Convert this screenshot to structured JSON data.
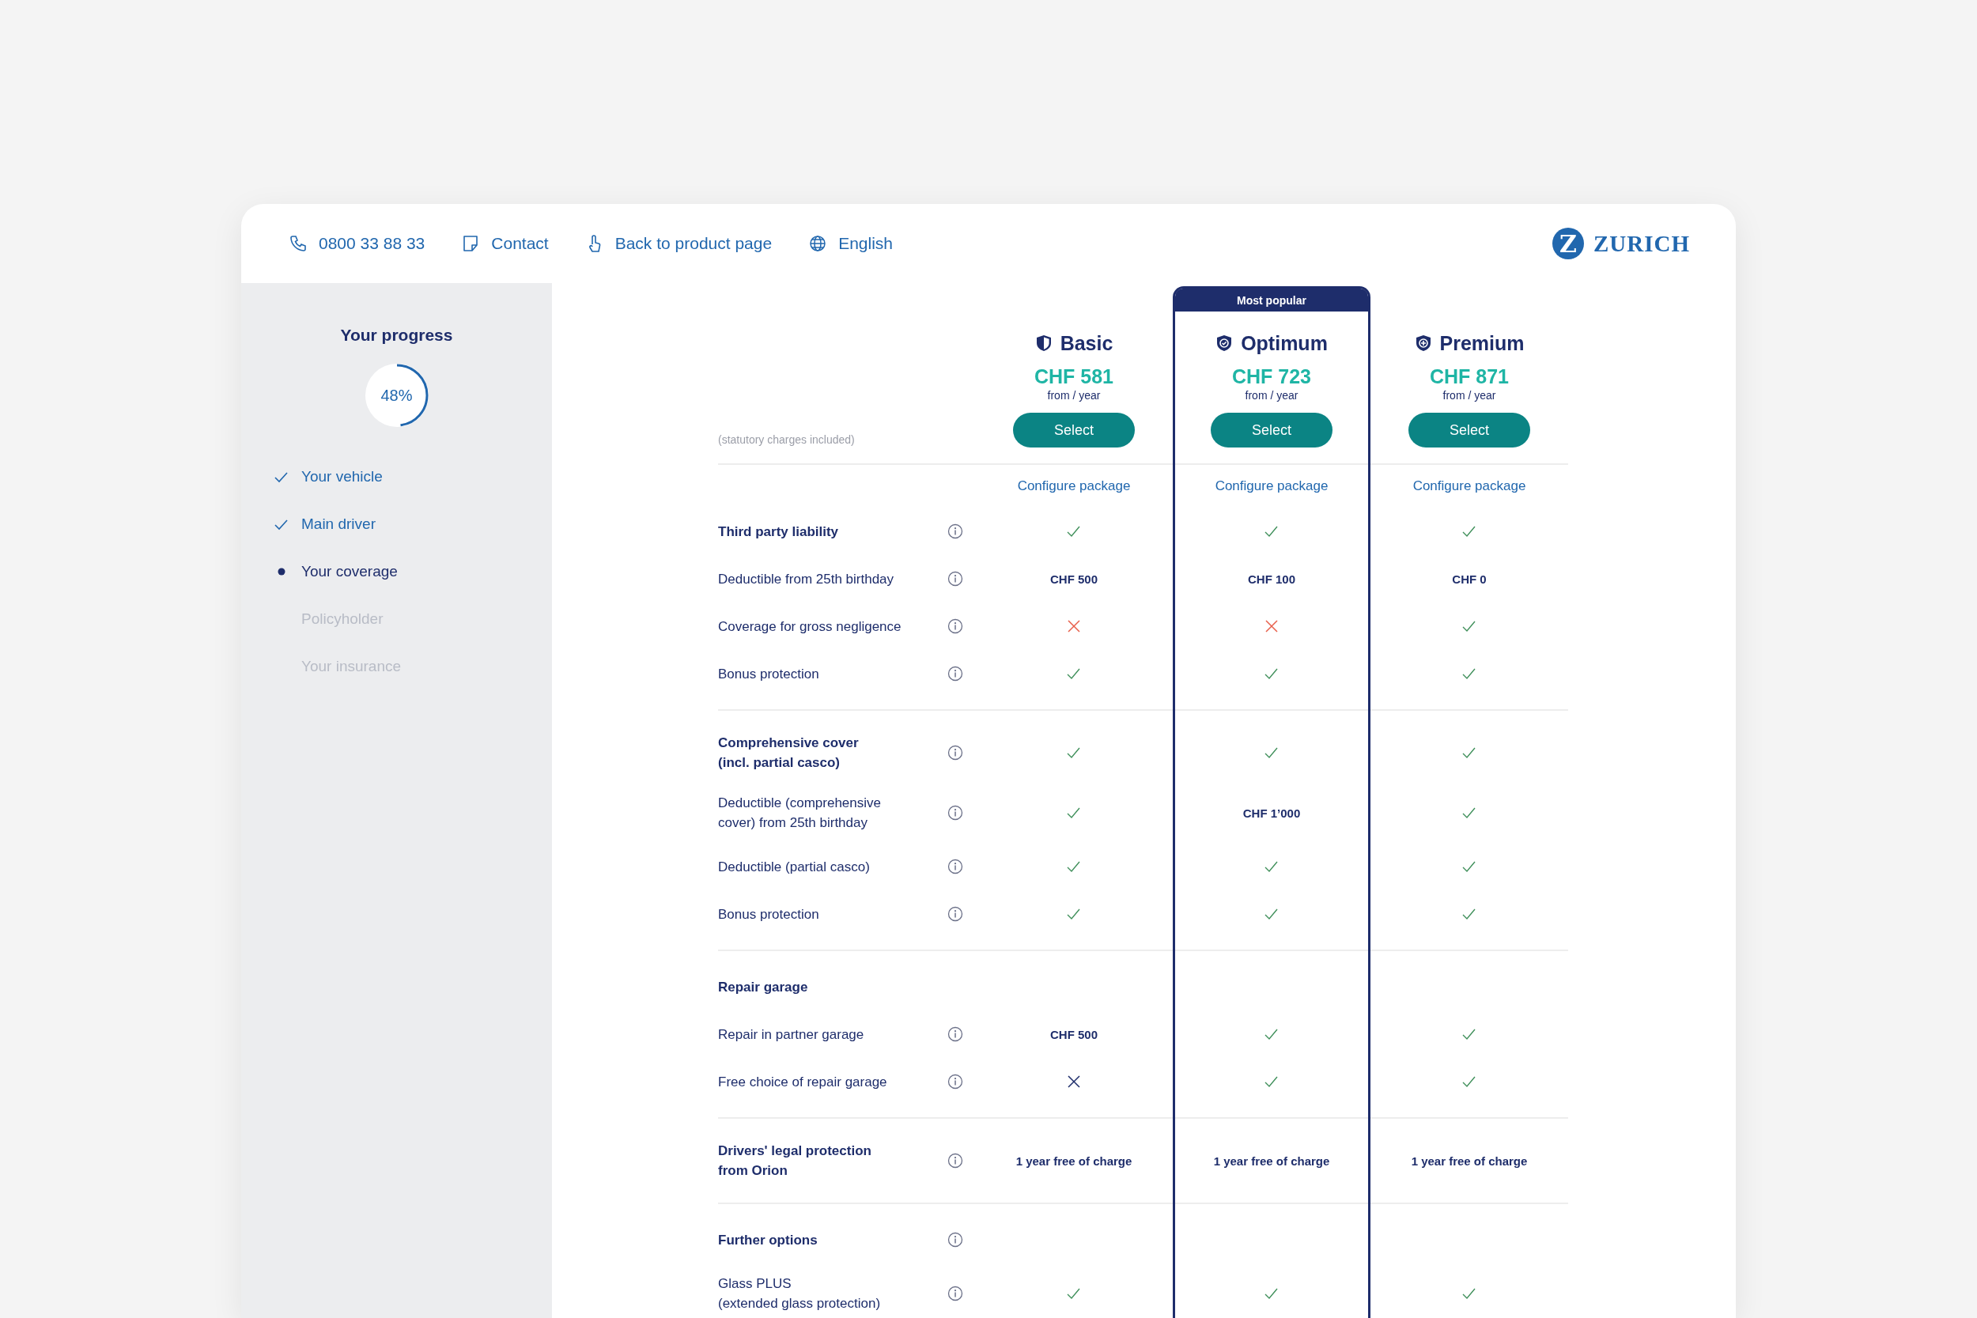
{
  "header": {
    "links": [
      {
        "text": "0800 33 88 33"
      },
      {
        "text": "Contact"
      },
      {
        "text": "Back to product page"
      },
      {
        "text": "English"
      }
    ],
    "logo": {
      "mark": "Z",
      "wordmark": "ZURICH"
    }
  },
  "sidebar": {
    "title": "Your progress",
    "progress": {
      "level": 0.48,
      "text": "48%"
    },
    "steps": [
      {
        "label": "Your vehicle",
        "completed": true,
        "current": false
      },
      {
        "label": "Main driver",
        "completed": true,
        "current": false
      },
      {
        "label": "Your coverage",
        "completed": false,
        "current": true
      },
      {
        "label": "Policyholder",
        "completed": false,
        "current": false
      },
      {
        "label": "Your insurance",
        "completed": false,
        "current": false
      }
    ]
  },
  "comparison": {
    "note": "(statutory charges included)",
    "plans": [
      {
        "name": "Basic",
        "price": "CHF 581",
        "period": "from / year",
        "button": "Select",
        "link": "Configure package",
        "highlighted": false
      },
      {
        "name": "Optimum",
        "price": "CHF 723",
        "period": "from / year",
        "button": "Select",
        "link": "Configure package",
        "highlighted": true,
        "badge": "Most popular"
      },
      {
        "name": "Premium",
        "price": "CHF 871",
        "period": "from / year",
        "button": "Select",
        "link": "Configure package",
        "highlighted": false
      }
    ],
    "sections": [
      {
        "rows": [
          {
            "label": "Third party liability",
            "bold": true,
            "info": true,
            "cells": [
              {
                "kind": "check"
              },
              {
                "kind": "check"
              },
              {
                "kind": "check"
              }
            ]
          },
          {
            "label": "Deductible from 25th birthday",
            "bold": false,
            "info": true,
            "cells": [
              {
                "kind": "text",
                "text": "CHF 500"
              },
              {
                "kind": "text",
                "text": "CHF 100"
              },
              {
                "kind": "text",
                "text": "CHF 0"
              }
            ]
          },
          {
            "label": "Coverage for gross negligence",
            "bold": false,
            "info": true,
            "cells": [
              {
                "kind": "cross",
                "color": "#e8604c"
              },
              {
                "kind": "cross",
                "color": "#e8604c"
              },
              {
                "kind": "check"
              }
            ]
          },
          {
            "label": "Bonus protection",
            "bold": false,
            "info": true,
            "cells": [
              {
                "kind": "check"
              },
              {
                "kind": "check"
              },
              {
                "kind": "check"
              }
            ]
          }
        ]
      },
      {
        "rows": [
          {
            "label": "Comprehensive cover\n(incl. partial casco)",
            "bold": true,
            "info": true,
            "cells": [
              {
                "kind": "check"
              },
              {
                "kind": "check"
              },
              {
                "kind": "check"
              }
            ]
          },
          {
            "label": "Deductible (comprehensive\ncover) from 25th birthday",
            "bold": false,
            "info": true,
            "cells": [
              {
                "kind": "check"
              },
              {
                "kind": "text",
                "text": "CHF 1’000"
              },
              {
                "kind": "check"
              }
            ]
          },
          {
            "label": "Deductible (partial casco)",
            "bold": false,
            "info": true,
            "cells": [
              {
                "kind": "check"
              },
              {
                "kind": "check"
              },
              {
                "kind": "check"
              }
            ]
          },
          {
            "label": "Bonus protection",
            "bold": false,
            "info": true,
            "cells": [
              {
                "kind": "check"
              },
              {
                "kind": "check"
              },
              {
                "kind": "check"
              }
            ]
          }
        ]
      },
      {
        "rows": [
          {
            "label": "Repair garage",
            "bold": true,
            "info": false,
            "cells": []
          },
          {
            "label": "Repair in partner garage",
            "bold": false,
            "info": true,
            "cells": [
              {
                "kind": "text",
                "text": "CHF 500"
              },
              {
                "kind": "check"
              },
              {
                "kind": "check"
              }
            ]
          },
          {
            "label": "Free choice of repair garage",
            "bold": false,
            "info": true,
            "cells": [
              {
                "kind": "cross",
                "color": "#1e2d6b"
              },
              {
                "kind": "check"
              },
              {
                "kind": "check"
              }
            ]
          }
        ]
      },
      {
        "rows": [
          {
            "label": "Drivers' legal protection\nfrom Orion",
            "bold": true,
            "info": true,
            "cells": [
              {
                "kind": "text",
                "text": "1 year free of charge"
              },
              {
                "kind": "text",
                "text": "1 year free of charge"
              },
              {
                "kind": "text",
                "text": "1 year free of charge"
              }
            ]
          }
        ]
      },
      {
        "rows": [
          {
            "label": "Further options",
            "bold": true,
            "info": true,
            "cells": []
          },
          {
            "label": "Glass PLUS\n(extended glass protection)",
            "bold": false,
            "info": true,
            "cells": [
              {
                "kind": "check"
              },
              {
                "kind": "check"
              },
              {
                "kind": "check"
              }
            ]
          }
        ]
      }
    ]
  }
}
